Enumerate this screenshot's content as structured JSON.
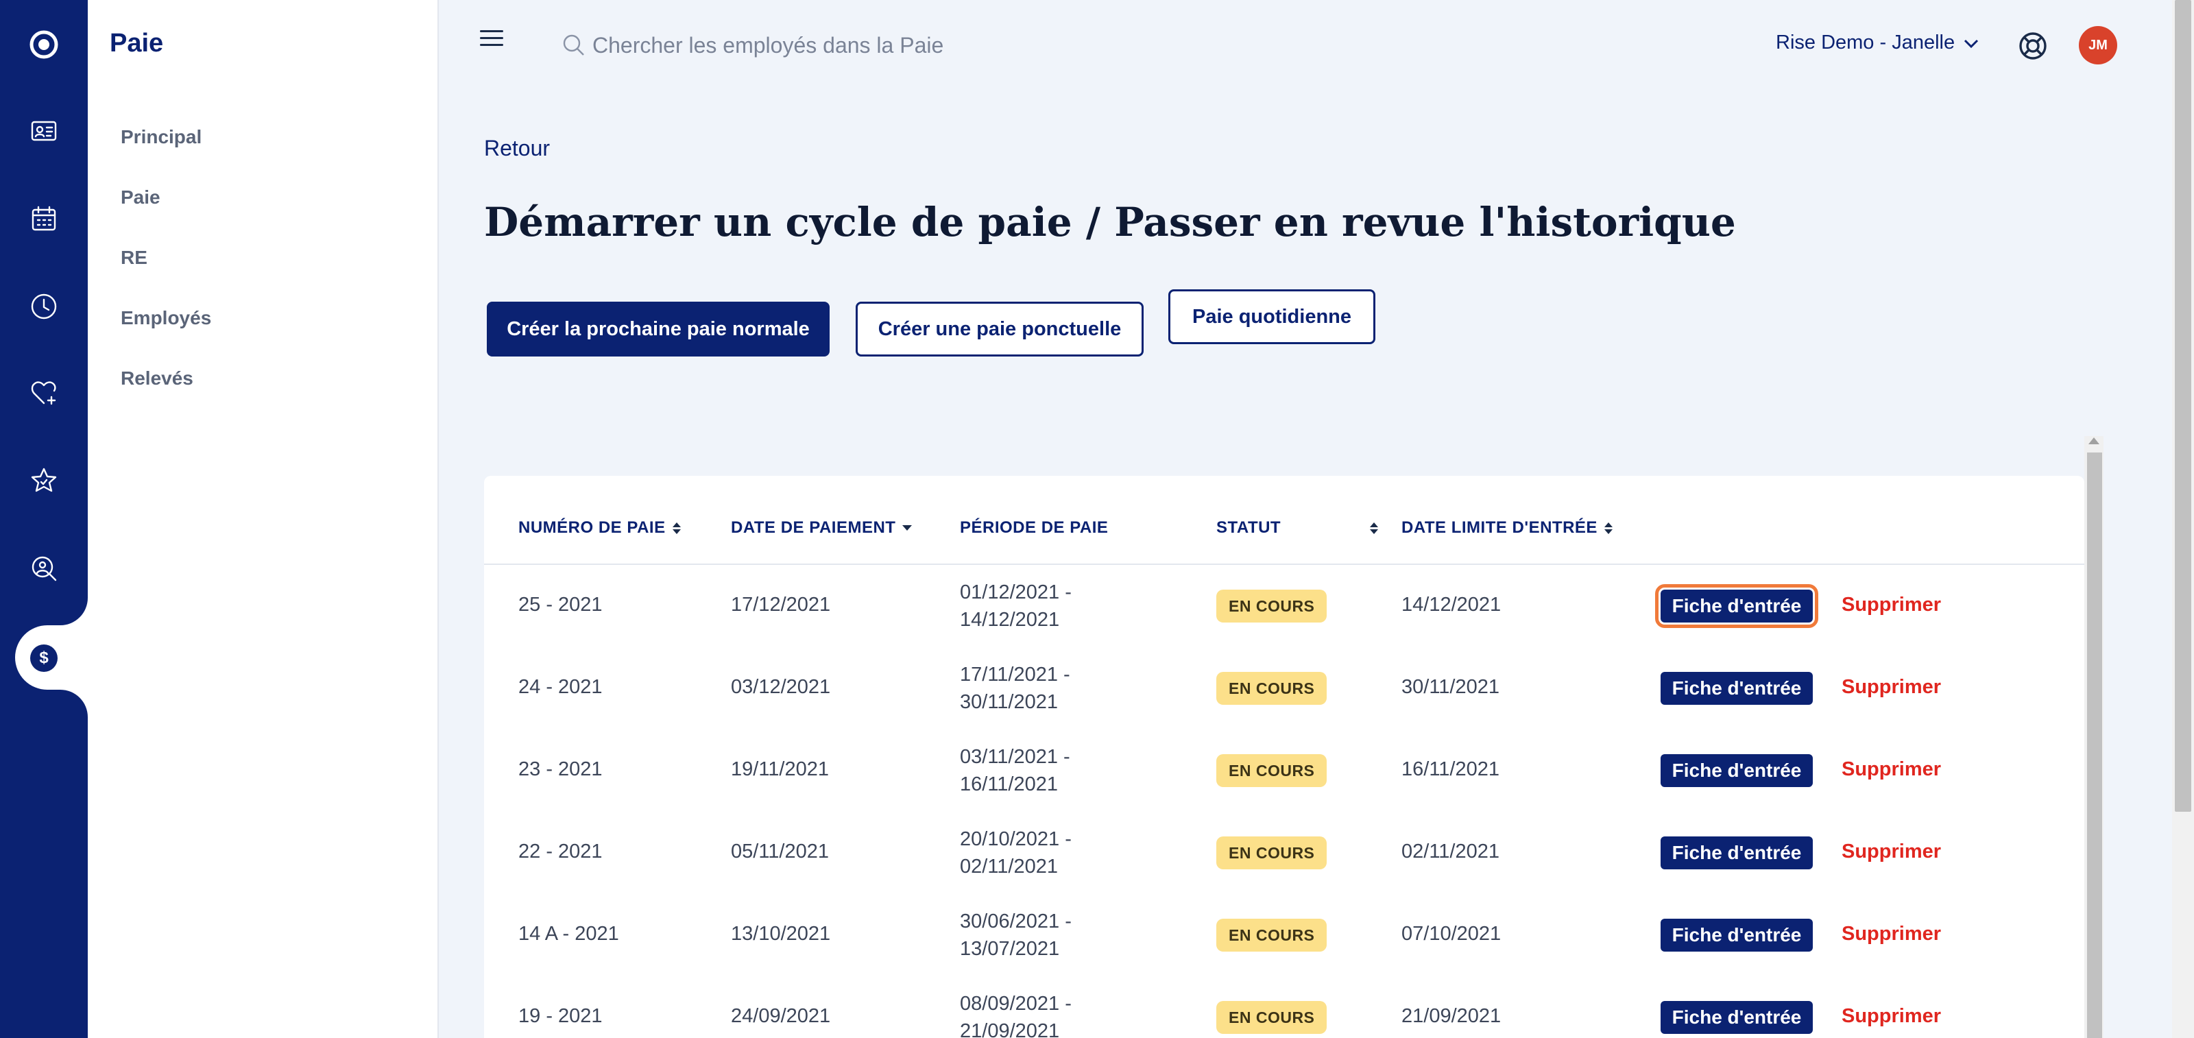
{
  "colors": {
    "navy": "#0b2272",
    "badge": "#fce08a",
    "delete": "#e0261f",
    "focus": "#f07a3a",
    "avatar": "#d9422b"
  },
  "rail": {
    "icons": [
      "logo-icon",
      "id-card-icon",
      "calendar-icon",
      "clock-icon",
      "heart-plus-icon",
      "star-icon",
      "person-search-icon",
      "dollar-icon"
    ],
    "active": "dollar-icon",
    "dollar_symbol": "$"
  },
  "subnav": {
    "title": "Paie",
    "items": [
      {
        "label": "Principal"
      },
      {
        "label": "Paie"
      },
      {
        "label": "RE"
      },
      {
        "label": "Employés"
      },
      {
        "label": "Relevés"
      }
    ]
  },
  "topbar": {
    "search_placeholder": "Chercher les employés dans la Paie",
    "company": "Rise Demo - Janelle",
    "avatar_initials": "JM"
  },
  "page": {
    "back": "Retour",
    "title": "Démarrer un cycle de paie / Passer en revue l'historique",
    "btn_next": "Créer la prochaine paie normale",
    "btn_oneoff": "Créer une paie ponctuelle",
    "btn_daily": "Paie quotidienne"
  },
  "table": {
    "headers": {
      "number": "NUMÉRO DE PAIE",
      "payment_date": "DATE DE PAIEMENT",
      "period": "PÉRIODE DE PAIE",
      "status": "STATUT",
      "deadline": "DATE LIMITE D'ENTRÉE"
    },
    "sorted_by": "payment_date",
    "sort_direction": "descending",
    "entry_label": "Fiche d'entrée",
    "delete_label": "Supprimer",
    "rows": [
      {
        "number": "25 - 2021",
        "payment_date": "17/12/2021",
        "period_start": "01/12/2021 -",
        "period_end": "14/12/2021",
        "status": "EN COURS",
        "deadline": "14/12/2021"
      },
      {
        "number": "24 - 2021",
        "payment_date": "03/12/2021",
        "period_start": "17/11/2021 -",
        "period_end": "30/11/2021",
        "status": "EN COURS",
        "deadline": "30/11/2021"
      },
      {
        "number": "23 - 2021",
        "payment_date": "19/11/2021",
        "period_start": "03/11/2021 -",
        "period_end": "16/11/2021",
        "status": "EN COURS",
        "deadline": "16/11/2021"
      },
      {
        "number": "22 - 2021",
        "payment_date": "05/11/2021",
        "period_start": "20/10/2021 -",
        "period_end": "02/11/2021",
        "status": "EN COURS",
        "deadline": "02/11/2021"
      },
      {
        "number": "14 A - 2021",
        "payment_date": "13/10/2021",
        "period_start": "30/06/2021 -",
        "period_end": "13/07/2021",
        "status": "EN COURS",
        "deadline": "07/10/2021"
      },
      {
        "number": "19 - 2021",
        "payment_date": "24/09/2021",
        "period_start": "08/09/2021 -",
        "period_end": "21/09/2021",
        "status": "EN COURS",
        "deadline": "21/09/2021"
      }
    ]
  }
}
